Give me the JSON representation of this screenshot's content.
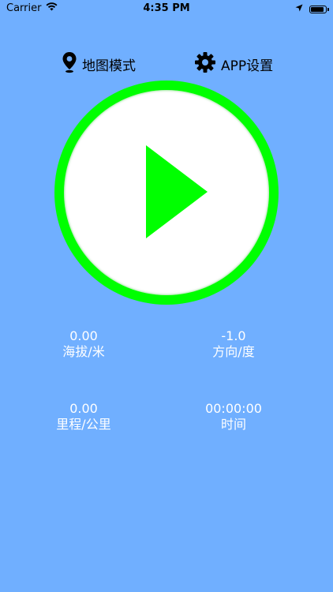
{
  "status_bar": {
    "carrier": "Carrier",
    "time": "4:35 PM"
  },
  "top_buttons": {
    "map_mode": "地图模式",
    "app_settings": "APP设置"
  },
  "play_button": {
    "icon": "play-icon",
    "ring_color": "#00FF00",
    "fill_color": "#FFFFFF"
  },
  "stats": {
    "altitude": {
      "value": "0.00",
      "label": "海拔/米"
    },
    "direction": {
      "value": "-1.0",
      "label": "方向/度"
    },
    "distance": {
      "value": "0.00",
      "label": "里程/公里"
    },
    "duration": {
      "value": "00:00:00",
      "label": "时间"
    }
  },
  "colors": {
    "background": "#70AFFF",
    "accent": "#00FF00"
  }
}
